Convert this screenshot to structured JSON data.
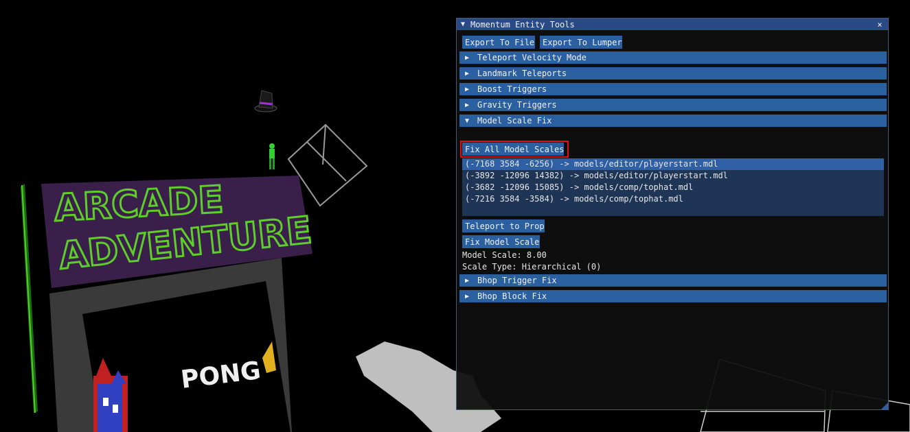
{
  "scene": {
    "arcade_sign_line1": "ARCADE",
    "arcade_sign_line2": "ADVENTURE",
    "screen_text": "PONG"
  },
  "window": {
    "title": "Momentum Entity Tools",
    "close_glyph": "×",
    "collapse_glyph": "▼",
    "export_file_label": "Export To File",
    "export_lumper_label": "Export To Lumper"
  },
  "sections": [
    {
      "label": "Teleport Velocity Mode",
      "expanded": false
    },
    {
      "label": "Landmark Teleports",
      "expanded": false
    },
    {
      "label": "Boost Triggers",
      "expanded": false
    },
    {
      "label": "Gravity Triggers",
      "expanded": false
    },
    {
      "label": "Model Scale Fix",
      "expanded": true
    },
    {
      "label": "Bhop Trigger Fix",
      "expanded": false
    },
    {
      "label": "Bhop Block Fix",
      "expanded": false
    }
  ],
  "glyphs": {
    "collapsed": "▶",
    "expanded": "▼"
  },
  "model_scale_fix": {
    "fix_all_label": "Fix All Model Scales",
    "props": [
      "(-7168 3584 -6256) -> models/editor/playerstart.mdl",
      "(-3892 -12096 14382) -> models/editor/playerstart.mdl",
      "(-3682 -12096 15085) -> models/comp/tophat.mdl",
      "(-7216 3584 -3584) -> models/comp/tophat.mdl"
    ],
    "selected_index": 0,
    "teleport_label": "Teleport to Prop",
    "fix_model_label": "Fix Model Scale",
    "model_scale_text": "Model Scale: 8.00",
    "scale_type_text": "Scale Type: Hierarchical (0)"
  },
  "colors": {
    "accent": "#2a5fa0",
    "title_bar": "#2a4a85",
    "highlight": "#e01010",
    "sign_green": "#5ecf2a",
    "sign_purple": "#3a1f4a"
  }
}
